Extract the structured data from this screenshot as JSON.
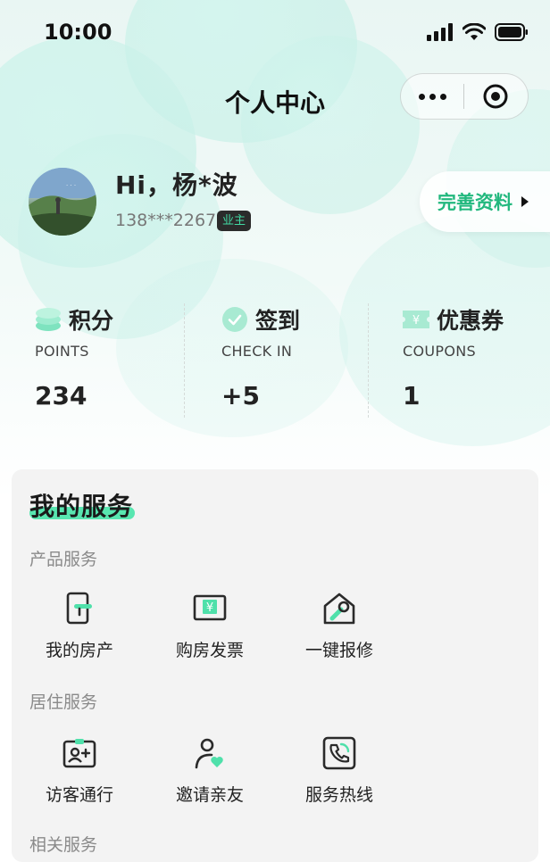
{
  "status_bar": {
    "time": "10:00"
  },
  "nav": {
    "title": "个人中心"
  },
  "profile": {
    "greeting": "Hi，杨*波",
    "phone": "138***2267",
    "badge": "业主",
    "complete_label": "完善资料"
  },
  "stats": [
    {
      "title": "积分",
      "subtitle": "POINTS",
      "value": "234",
      "icon": "coins-icon"
    },
    {
      "title": "签到",
      "subtitle": "CHECK IN",
      "value": "+5",
      "icon": "check-circle-icon"
    },
    {
      "title": "优惠券",
      "subtitle": "COUPONS",
      "value": "1",
      "icon": "coupon-icon"
    }
  ],
  "services": {
    "title": "我的服务",
    "sections": [
      {
        "label": "产品服务",
        "items": [
          {
            "label": "我的房产",
            "icon": "door-key-icon"
          },
          {
            "label": "购房发票",
            "icon": "invoice-icon"
          },
          {
            "label": "一键报修",
            "icon": "house-wrench-icon"
          }
        ]
      },
      {
        "label": "居住服务",
        "items": [
          {
            "label": "访客通行",
            "icon": "visitor-pass-icon"
          },
          {
            "label": "邀请亲友",
            "icon": "invite-friend-icon"
          },
          {
            "label": "服务热线",
            "icon": "phone-icon"
          }
        ]
      },
      {
        "label": "相关服务"
      }
    ]
  },
  "colors": {
    "accent": "#22b87e",
    "highlight": "#58e6b0",
    "badge_bg": "#2b2b2b",
    "badge_text": "#42d9a3"
  }
}
